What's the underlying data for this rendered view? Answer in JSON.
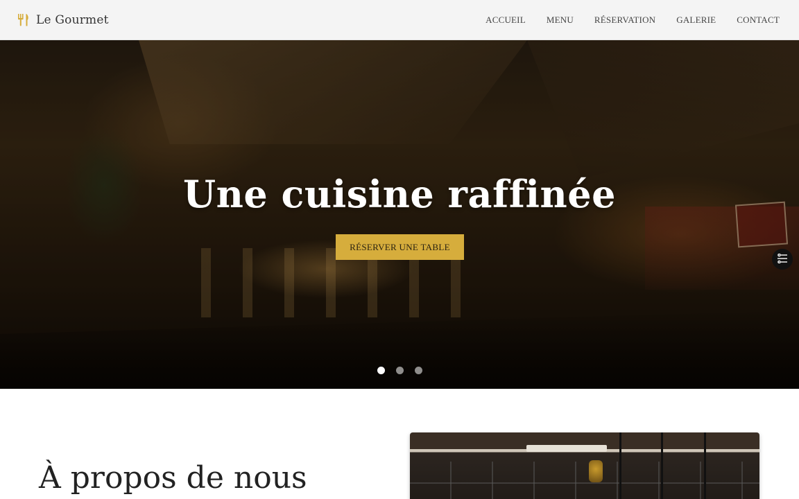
{
  "header": {
    "brand": "Le Gourmet",
    "brand_icon": "utensils-icon",
    "nav": [
      "ACCUEIL",
      "MENU",
      "RÉSERVATION",
      "GALERIE",
      "CONTACT"
    ]
  },
  "hero": {
    "title": "Une cuisine raffinée",
    "cta": "RÉSERVER UNE TABLE",
    "side_icon": "settings-sliders-icon",
    "slides_count": 3,
    "active_slide": 1
  },
  "about": {
    "title": "À propos de nous"
  },
  "colors": {
    "accent": "#d6ad3c",
    "header_bg": "#f4f4f4",
    "text_dark": "#222222"
  }
}
